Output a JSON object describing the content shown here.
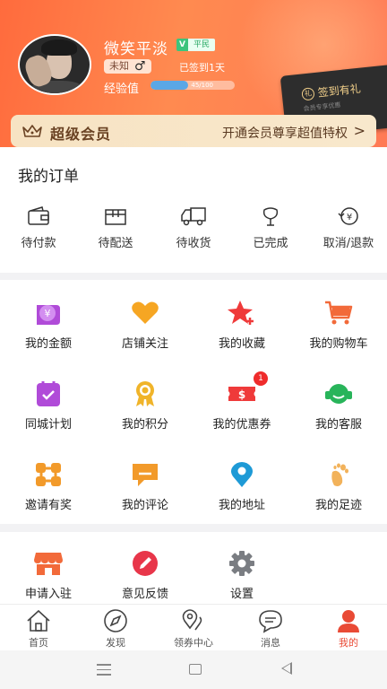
{
  "profile": {
    "username": "微笑平淡",
    "vip_badge": "V",
    "vip_level": "平民",
    "gender_text": "未知",
    "gender_symbol": "♂",
    "signed_in": "已签到1天",
    "exp_label": "经验值",
    "exp_text": "45/100",
    "exp_fraction": 0.45
  },
  "sign_card": {
    "title": "签到有礼",
    "subtitle": "会员专享优惠"
  },
  "super_member": {
    "title": "超级会员",
    "desc": "开通会员尊享超值特权",
    "arrow": ">"
  },
  "orders": {
    "title": "我的订单",
    "items": [
      {
        "label": "待付款",
        "icon": "wallet-icon"
      },
      {
        "label": "待配送",
        "icon": "package-icon"
      },
      {
        "label": "待收货",
        "icon": "truck-icon"
      },
      {
        "label": "已完成",
        "icon": "flower-check-icon"
      },
      {
        "label": "取消/退款",
        "icon": "yen-refund-icon"
      }
    ]
  },
  "features": [
    {
      "label": "我的金额",
      "icon": "wallet-yen-icon"
    },
    {
      "label": "店铺关注",
      "icon": "heart-icon"
    },
    {
      "label": "我的收藏",
      "icon": "star-plus-icon"
    },
    {
      "label": "我的购物车",
      "icon": "cart-icon"
    },
    {
      "label": "同城计划",
      "icon": "calendar-check-icon"
    },
    {
      "label": "我的积分",
      "icon": "medal-icon"
    },
    {
      "label": "我的优惠券",
      "icon": "coupon-icon",
      "badge": "1"
    },
    {
      "label": "我的客服",
      "icon": "headset-icon"
    },
    {
      "label": "邀请有奖",
      "icon": "share-nodes-icon"
    },
    {
      "label": "我的评论",
      "icon": "comment-icon"
    },
    {
      "label": "我的地址",
      "icon": "location-pin-icon"
    },
    {
      "label": "我的足迹",
      "icon": "footprint-icon"
    }
  ],
  "more": [
    {
      "label": "申请入驻",
      "icon": "shop-icon"
    },
    {
      "label": "意见反馈",
      "icon": "pencil-icon"
    },
    {
      "label": "设置",
      "icon": "gear-icon"
    }
  ],
  "tabs": [
    {
      "label": "首页",
      "icon": "home-icon"
    },
    {
      "label": "发现",
      "icon": "compass-icon"
    },
    {
      "label": "领券中心",
      "icon": "map-pin-icon"
    },
    {
      "label": "消息",
      "icon": "message-icon"
    },
    {
      "label": "我的",
      "icon": "user-icon",
      "active": true
    }
  ],
  "colors": {
    "header": "#ff7a4a",
    "accent": "#e94a35",
    "gold": "#6a4223"
  }
}
